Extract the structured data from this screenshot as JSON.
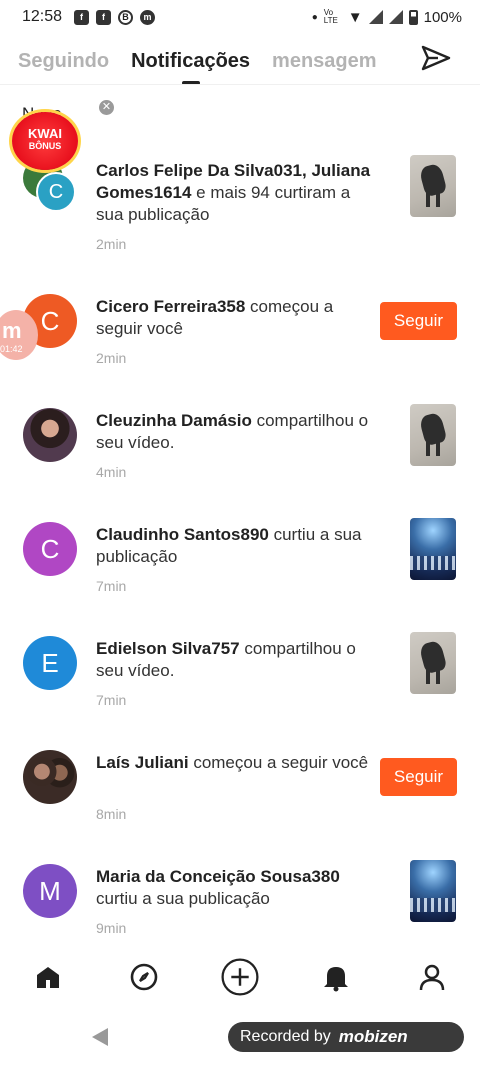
{
  "status_bar": {
    "time": "12:58",
    "battery": "100%",
    "network": "Vo LTE"
  },
  "tabs": [
    {
      "label": "Seguindo",
      "active": false
    },
    {
      "label": "Notificações",
      "active": true
    },
    {
      "label": "mensagem",
      "active": false
    }
  ],
  "overlay": {
    "novo_label": "Novo",
    "kwai_title": "KWAI",
    "kwai_sub": "BÔNUS",
    "mobizen_timer": "01:42"
  },
  "notifications": [
    {
      "name": "Carlos Felipe Da Silva031",
      "joiner": ", ",
      "name2": "Juliana Gomes1614",
      "action": " e mais 94 curtiram a sua publicação",
      "time": "2min",
      "avatar_letter": "C",
      "avatar_color": "#2aa1c4"
    },
    {
      "name": "Cicero Ferreira358",
      "action": " começou a seguir você",
      "time": "2min",
      "avatar_letter": "C",
      "avatar_color": "#ee5a24",
      "button": "Seguir"
    },
    {
      "name": "Cleuzinha Damásio",
      "action": " compartilhou o seu vídeo.",
      "time": "4min"
    },
    {
      "name": "Claudinho Santos890",
      "action": " curtiu a sua publicação",
      "time": "7min",
      "avatar_letter": "C",
      "avatar_color": "#b047c4"
    },
    {
      "name": "Edielson Silva757",
      "action": " compartilhou o seu vídeo.",
      "time": "7min",
      "avatar_letter": "E",
      "avatar_color": "#1f8ad8"
    },
    {
      "name": "Laís Juliani",
      "action": " começou a seguir você",
      "time": "8min",
      "button": "Seguir"
    },
    {
      "name": "Maria da Conceição Sousa380",
      "action": " curtiu a sua publicação",
      "time": "9min",
      "avatar_letter": "M",
      "avatar_color": "#7e4fc4"
    }
  ],
  "recorder": {
    "prefix": "Recorded by",
    "brand": "mobizen"
  },
  "colors": {
    "accent": "#ff5a1f",
    "inactive_tab": "#b3b3b3"
  }
}
